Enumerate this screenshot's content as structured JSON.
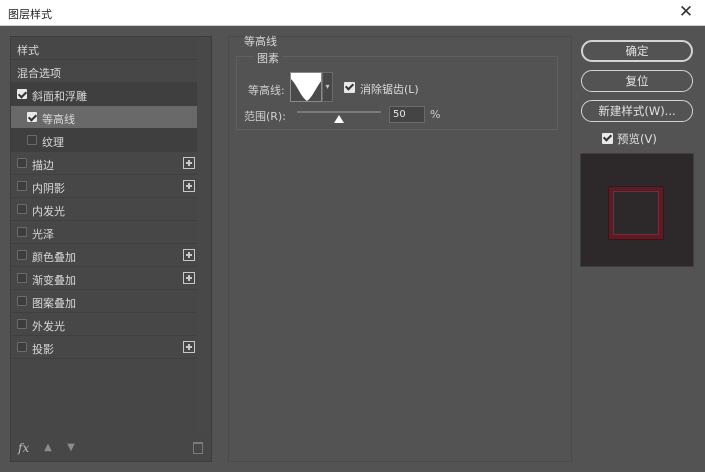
{
  "window": {
    "title": "图层样式"
  },
  "styles_list": {
    "items": [
      {
        "label": "样式"
      },
      {
        "label": "混合选项"
      },
      {
        "label": "斜面和浮雕"
      },
      {
        "label": "等高线"
      },
      {
        "label": "纹理"
      },
      {
        "label": "描边"
      },
      {
        "label": "内阴影"
      },
      {
        "label": "内发光"
      },
      {
        "label": "光泽"
      },
      {
        "label": "颜色叠加"
      },
      {
        "label": "渐变叠加"
      },
      {
        "label": "图案叠加"
      },
      {
        "label": "外发光"
      },
      {
        "label": "投影"
      }
    ],
    "footer": {
      "fx_label": "fx"
    }
  },
  "contour_panel": {
    "group_title": "等高线",
    "section_title": "图素",
    "contour_label": "等高线:",
    "anti_alias_label": "消除锯齿(L)",
    "anti_alias_checked": true,
    "range_label": "范围(R):",
    "range_value": "50",
    "range_unit": "%",
    "range_fraction": 0.5
  },
  "buttons": {
    "ok": "确定",
    "reset": "复位",
    "new_style": "新建样式(W)..."
  },
  "preview": {
    "label": "预览(V)",
    "checked": true
  },
  "colors": {
    "dialog_bg": "#535353",
    "list_bg": "#474747",
    "selected_row": "#696969",
    "preview_bg": "#2d292a",
    "preview_frame": "#5a1c24"
  }
}
